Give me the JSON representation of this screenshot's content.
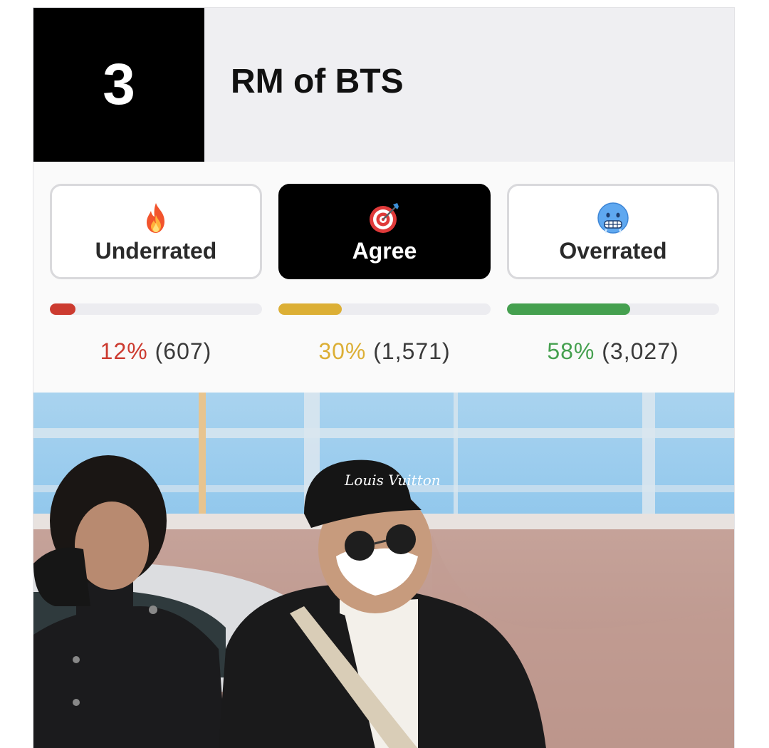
{
  "header": {
    "rank": "3",
    "title": "RM of BTS"
  },
  "votes": [
    {
      "label": "Underrated",
      "icon": "fire-icon",
      "percent": "12%",
      "count": "(607)",
      "fraction": 0.12,
      "color": "#cc3b30",
      "active": false
    },
    {
      "label": "Agree",
      "icon": "target-icon",
      "percent": "30%",
      "count": "(1,571)",
      "fraction": 0.3,
      "color": "#dcaf35",
      "active": true
    },
    {
      "label": "Overrated",
      "icon": "freezing-face-icon",
      "percent": "58%",
      "count": "(3,027)",
      "fraction": 0.58,
      "color": "#45a04f",
      "active": false
    }
  ],
  "photo": {
    "cap_text": "Louis Vuitton"
  }
}
